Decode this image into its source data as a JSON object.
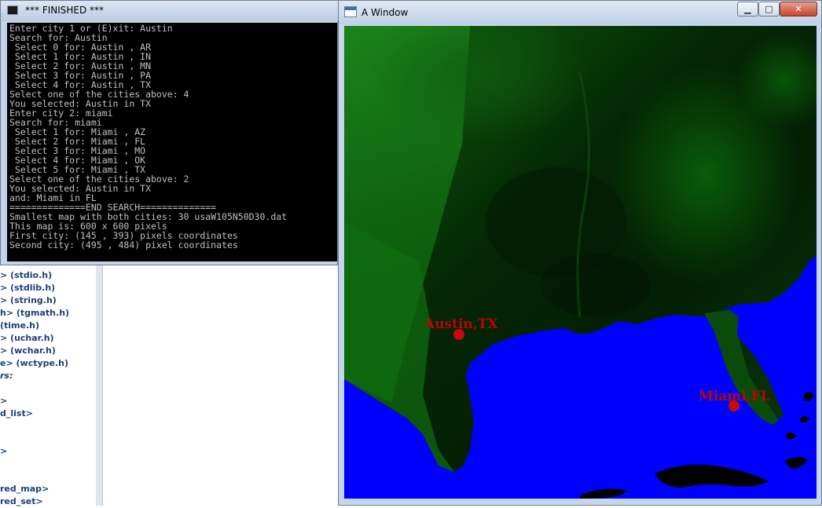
{
  "console": {
    "title": "*** FINISHED ***",
    "lines": [
      "Enter city 1 or (E)xit: Austin",
      "Search for: Austin",
      " Select 0 for: Austin , AR",
      " Select 1 for: Austin , IN",
      " Select 2 for: Austin , MN",
      " Select 3 for: Austin , PA",
      " Select 4 for: Austin , TX",
      "Select one of the cities above: 4",
      "You selected: Austin in TX",
      "Enter city 2: miami",
      "Search for: miami",
      " Select 1 for: Miami , AZ",
      " Select 2 for: Miami , FL",
      " Select 3 for: Miami , MO",
      " Select 4 for: Miami , OK",
      " Select 5 for: Miami , TX",
      "Select one of the cities above: 2",
      "You selected: Austin in TX",
      "and: Miami in FL",
      "==============END SEARCH==============",
      "Smallest map with both cities: 30 usaW105N50D30.dat",
      "This map is: 600 x 600 pixels",
      "First city: (145 , 393) pixels coordinates",
      "Second city: (495 , 484) pixel coordinates"
    ]
  },
  "map_window": {
    "title": "A Window",
    "buttons": {
      "minimize": "▁",
      "maximize": "□",
      "close": "✕"
    },
    "colors": {
      "ocean": "#0000ff",
      "marker": "#c90808"
    },
    "cities": [
      {
        "label": "Austin,TX"
      },
      {
        "label": "Miami,FL"
      }
    ]
  },
  "ide_background": {
    "items": [
      "> (stdio.h)",
      "> (stdlib.h)",
      "> (string.h)",
      "h> (tgmath.h)",
      " (time.h)",
      "> (uchar.h)",
      "> (wchar.h)",
      "e> (wctype.h)",
      "rs:",
      ">",
      "d_list>",
      ">",
      "red_map>",
      "red_set>"
    ]
  }
}
